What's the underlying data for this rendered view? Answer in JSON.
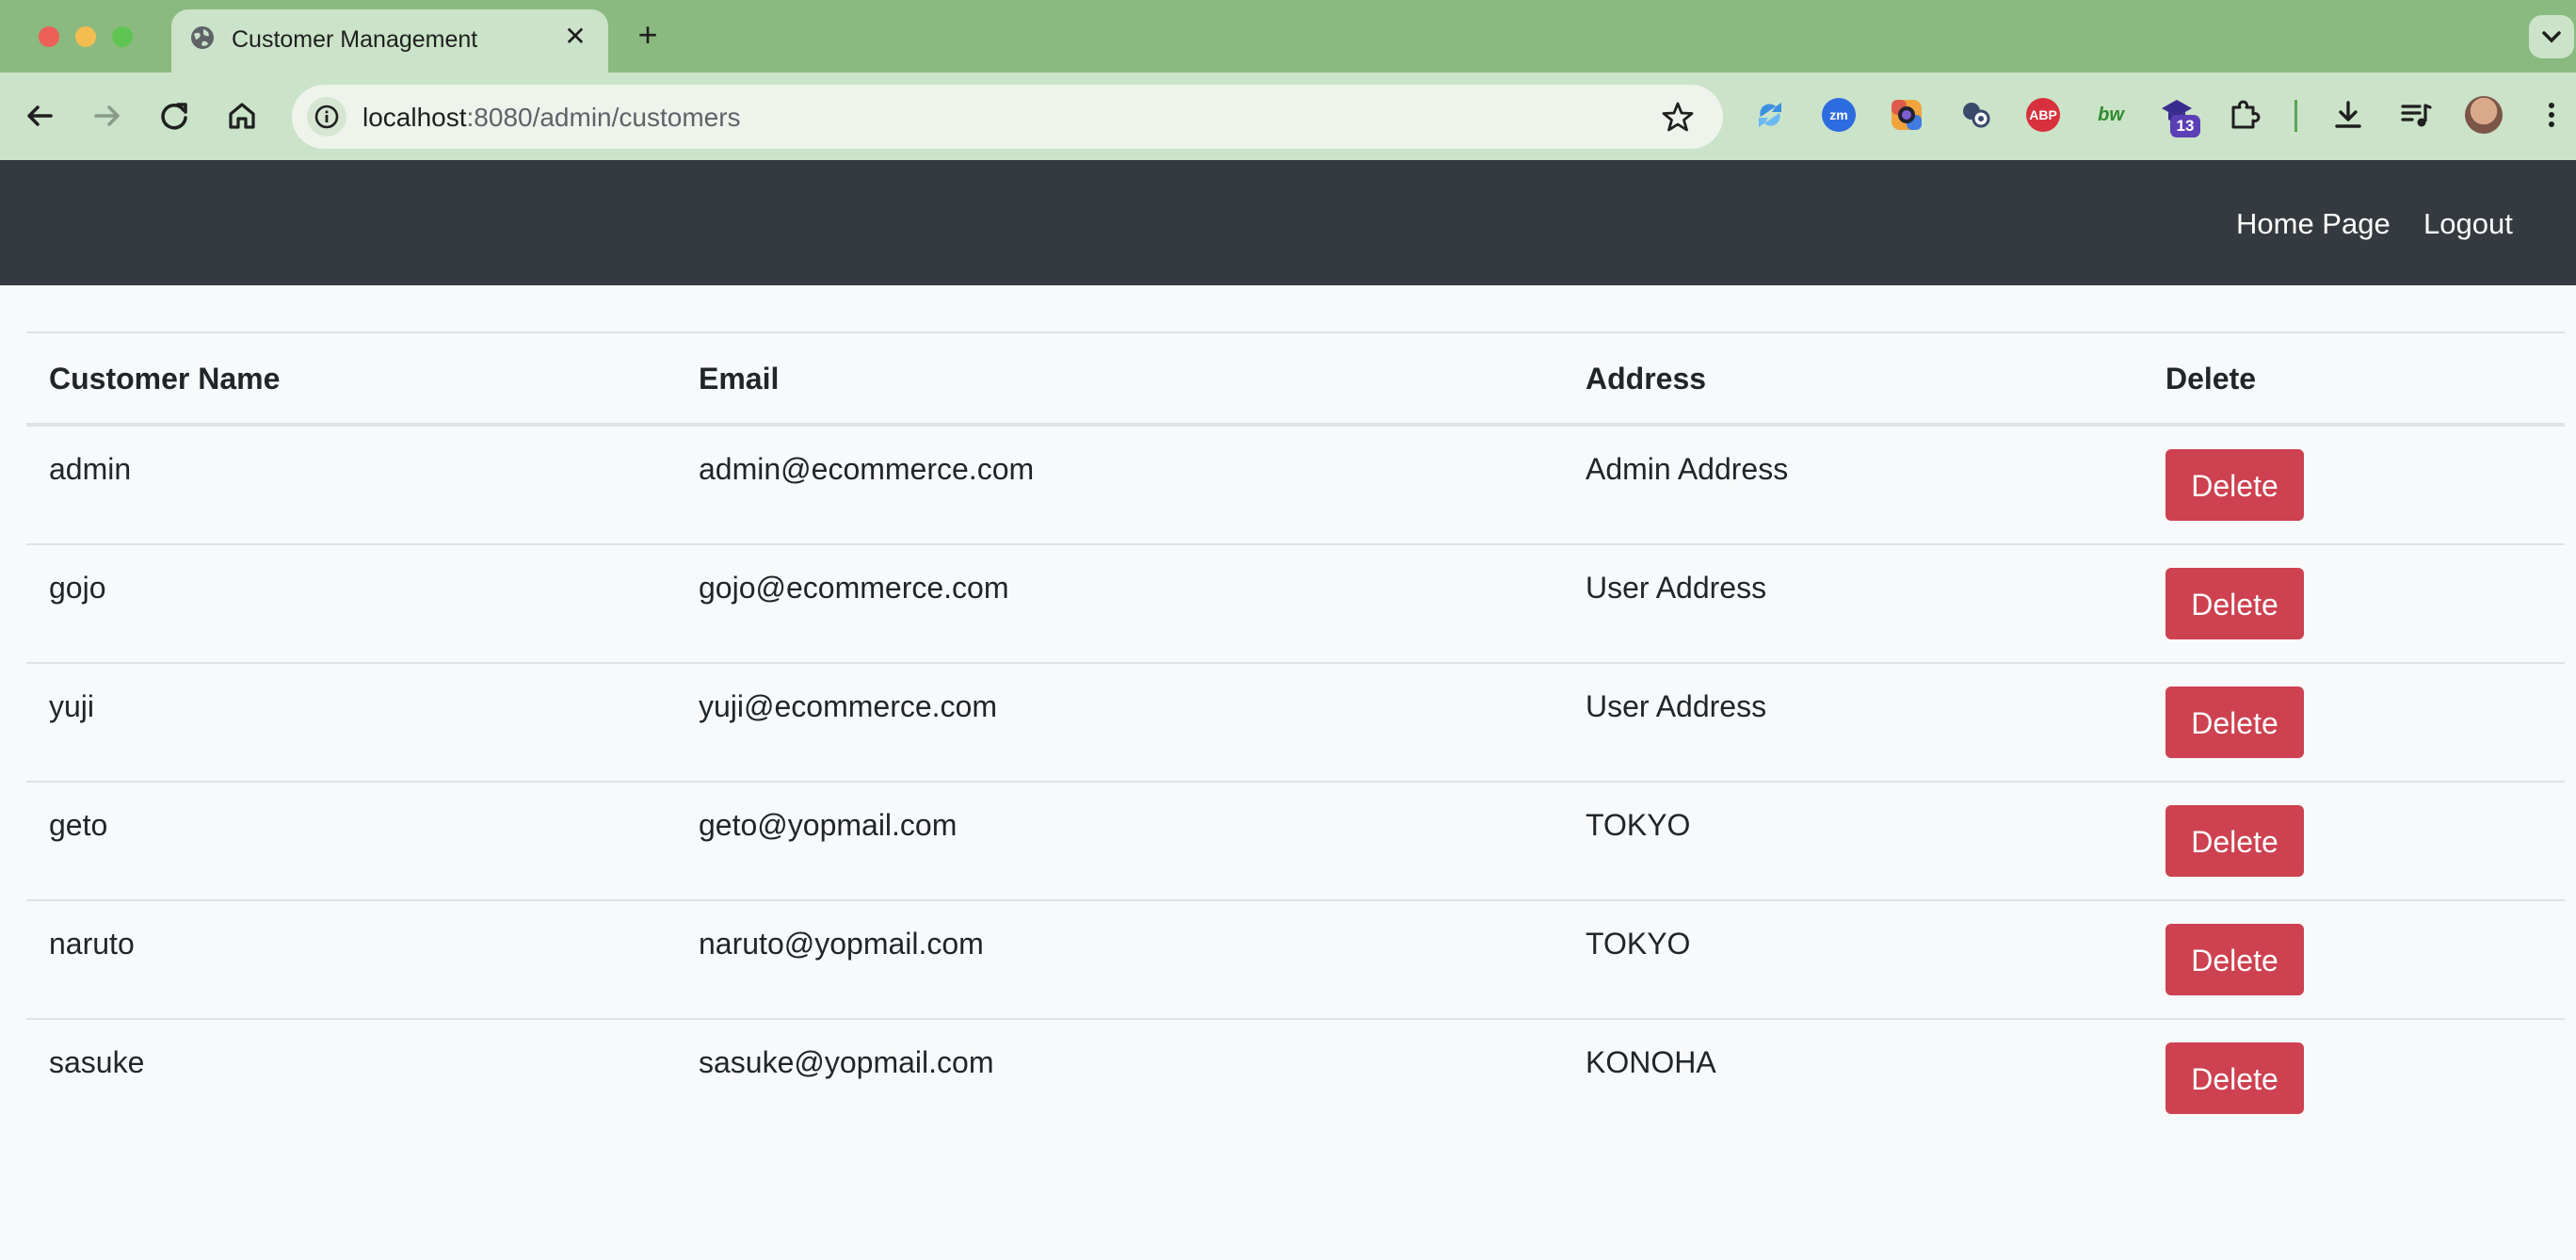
{
  "browser": {
    "tab_title": "Customer Management",
    "new_tab_label": "+",
    "url_host": "localhost",
    "url_rest": ":8080/admin/customers",
    "extension_badge_count": "13",
    "extensions": [
      "sync-icon",
      "zoom-icon",
      "color-picker-icon",
      "password-icon",
      "adblock-plus-icon",
      "bw-icon",
      "graduation-cap-icon",
      "puzzle-icon"
    ],
    "adblock_label": "ABP",
    "bw_label": "bw",
    "zm_label": "zm"
  },
  "navbar": {
    "home_label": "Home Page",
    "logout_label": "Logout"
  },
  "table": {
    "headers": [
      "Customer Name",
      "Email",
      "Address",
      "Delete"
    ],
    "rows": [
      {
        "name": "admin",
        "email": "admin@ecommerce.com",
        "address": "Admin Address",
        "action": "Delete"
      },
      {
        "name": "gojo",
        "email": "gojo@ecommerce.com",
        "address": "User Address",
        "action": "Delete"
      },
      {
        "name": "yuji",
        "email": "yuji@ecommerce.com",
        "address": "User Address",
        "action": "Delete"
      },
      {
        "name": "geto",
        "email": "geto@yopmail.com",
        "address": "TOKYO",
        "action": "Delete"
      },
      {
        "name": "naruto",
        "email": "naruto@yopmail.com",
        "address": "TOKYO",
        "action": "Delete"
      },
      {
        "name": "sasuke",
        "email": "sasuke@yopmail.com",
        "address": "KONOHA",
        "action": "Delete"
      }
    ]
  },
  "colors": {
    "navbar_bg": "#343a40",
    "delete_button": "#cd4150",
    "tabstrip_bg": "#8aba7f",
    "toolbar_bg": "#cbe3c8"
  }
}
